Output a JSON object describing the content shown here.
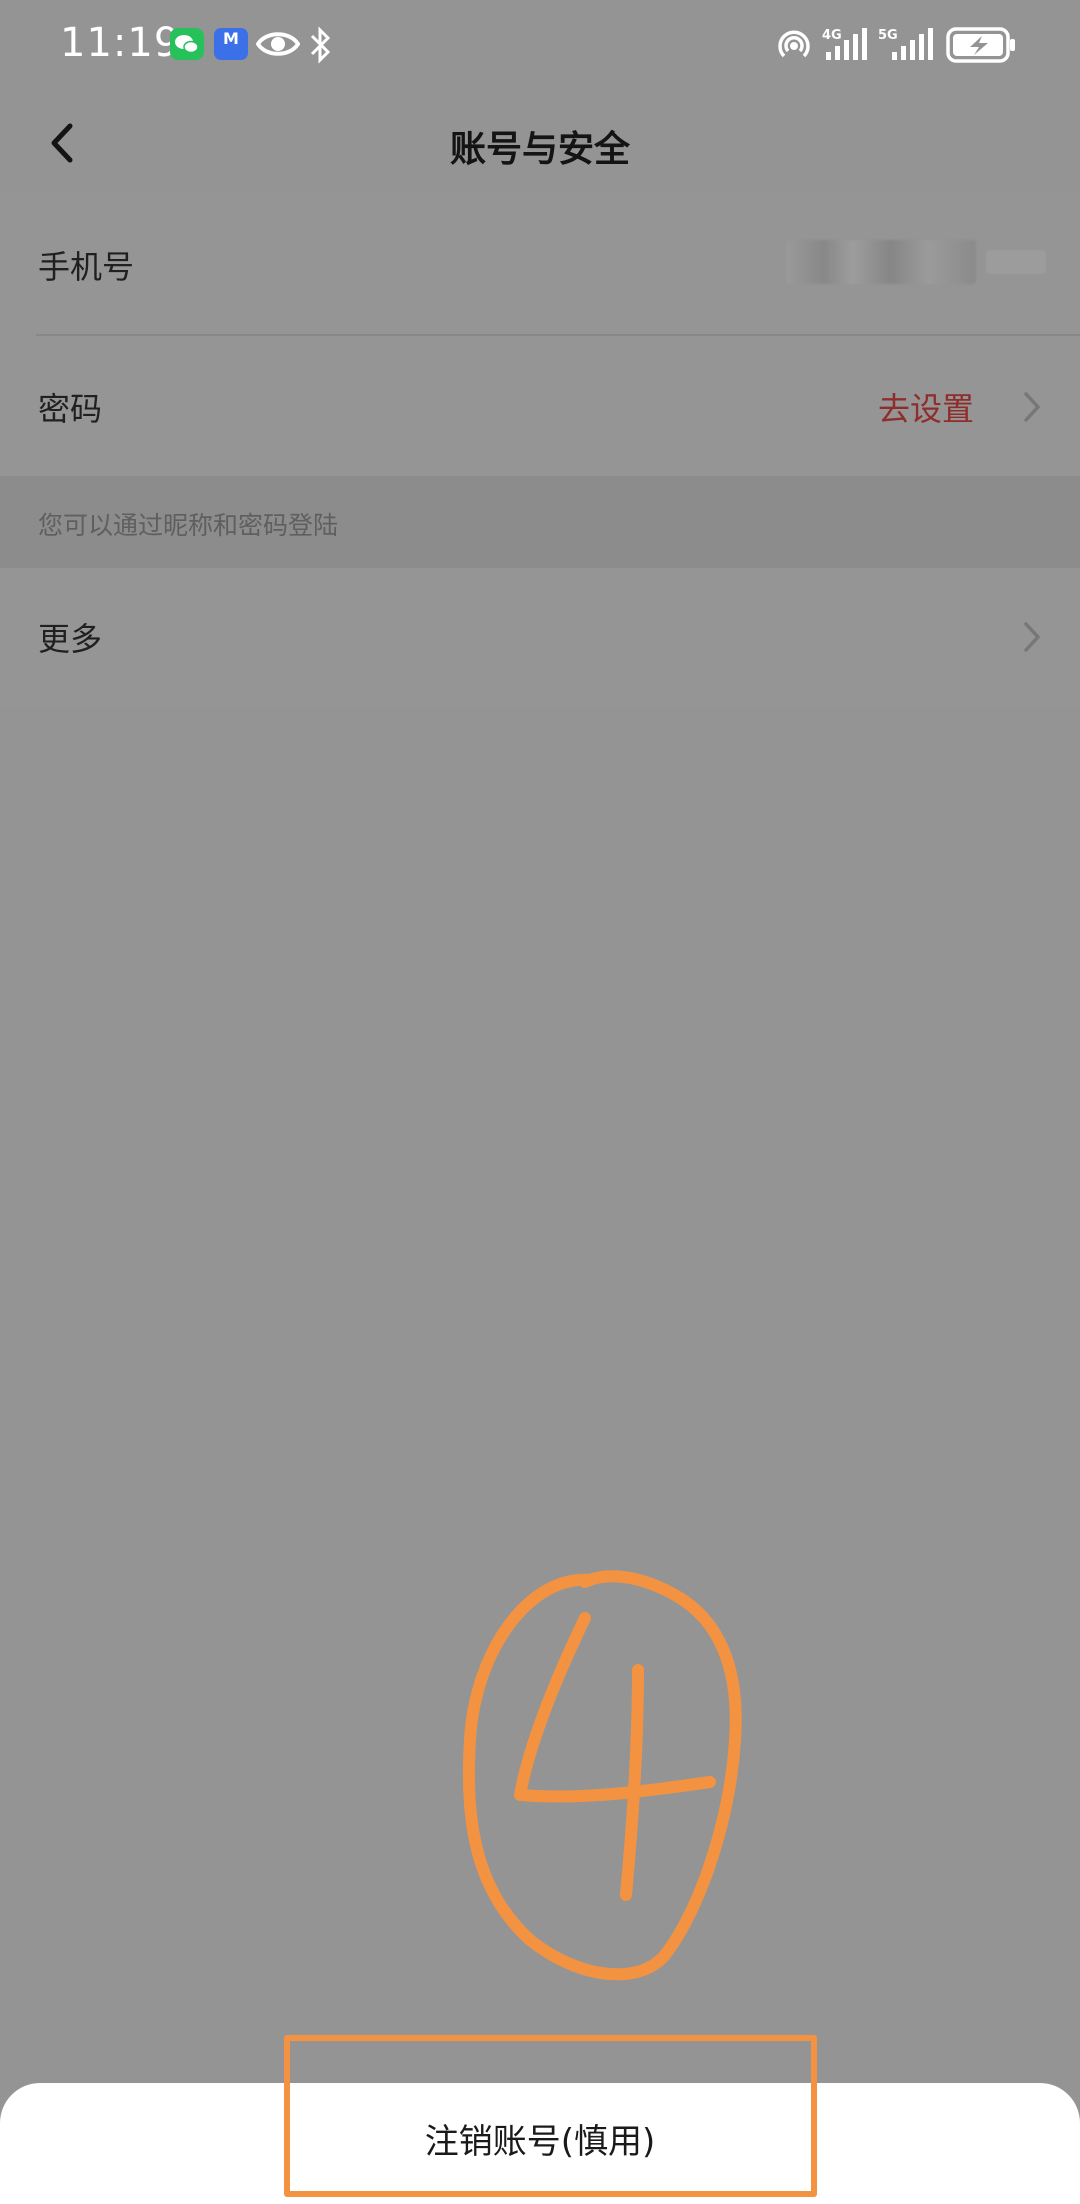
{
  "status_bar": {
    "time": "11:19",
    "icons": [
      "wechat-icon",
      "app-m-icon",
      "eye-icon",
      "bluetooth-icon",
      "hotspot-icon",
      "signal-4g-icon",
      "signal-5g-icon",
      "battery-charging-icon"
    ],
    "net_4g": "4G",
    "net_5g": "5G",
    "app_badge": "M"
  },
  "header": {
    "title": "账号与安全",
    "back_icon": "chevron-left-icon"
  },
  "rows": {
    "phone_label": "手机号",
    "password_label": "密码",
    "password_action": "去设置",
    "hint": "您可以通过昵称和密码登陆",
    "more_label": "更多"
  },
  "annotation": {
    "number": "4",
    "color": "#f39342"
  },
  "bottom_sheet": {
    "button_label": "注销账号(慎用)"
  },
  "colors": {
    "overlay_bg": "#949494",
    "accent_red": "#8e2d2b",
    "annotation_orange": "#f39342"
  }
}
